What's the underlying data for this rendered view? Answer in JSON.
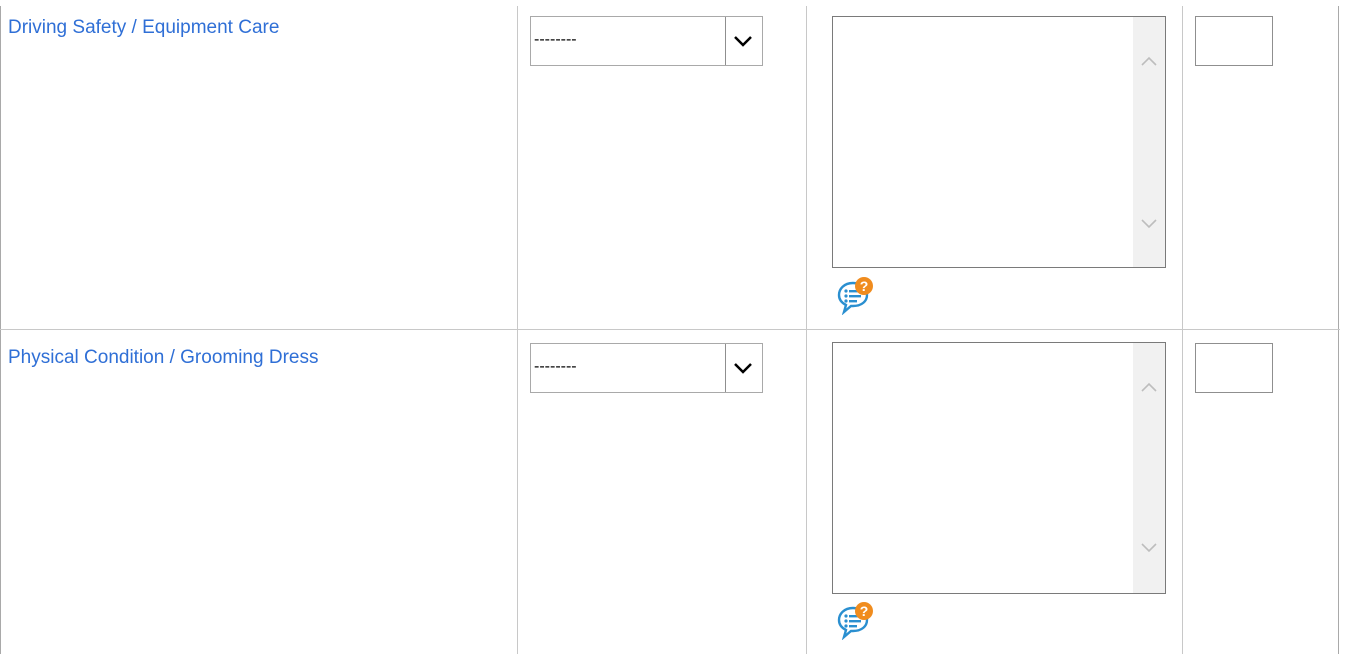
{
  "rows": [
    {
      "criterion": "Driving Safety / Equipment Care",
      "rating": "--------",
      "comment": "",
      "score": ""
    },
    {
      "criterion": "Physical Condition / Grooming Dress",
      "rating": "--------",
      "comment": "",
      "score": ""
    }
  ],
  "icons": {
    "dropdown": "chevron-down-icon",
    "scroll_up": "chevron-up-icon",
    "scroll_down": "chevron-down-icon",
    "help": "comment-help-icon"
  },
  "colors": {
    "link": "#2f6fd6",
    "help_bubble": "#2a8fd0",
    "help_badge": "#f08c1e"
  }
}
